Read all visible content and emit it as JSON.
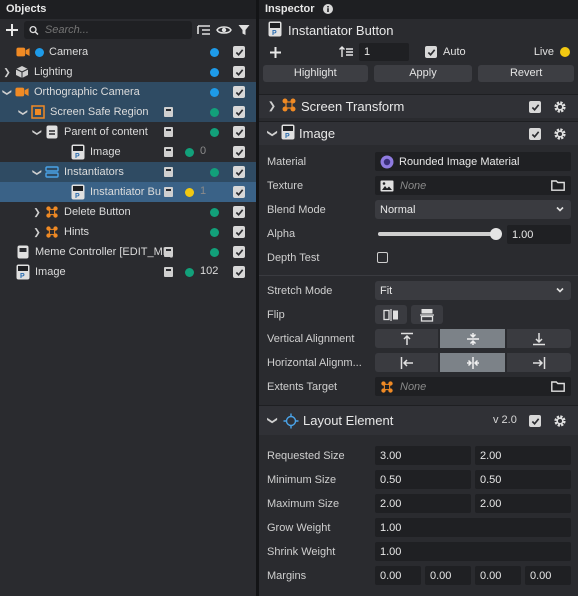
{
  "objects": {
    "title": "Objects",
    "search_placeholder": "Search...",
    "items": [
      {
        "label": "Camera",
        "icon": "camera-icon",
        "expand": "",
        "dot": "#1e9be9",
        "layer": false,
        "count": ""
      },
      {
        "label": "Lighting",
        "icon": "lighting-cube-icon",
        "expand": "right",
        "dot": "#1e9be9",
        "layer": false,
        "count": ""
      },
      {
        "label": "Orthographic Camera",
        "icon": "camera-icon",
        "expand": "down",
        "dot": "#1e9be9",
        "layer": false,
        "count": ""
      },
      {
        "label": "Screen Safe Region",
        "icon": "screen-region-icon",
        "expand": "down",
        "dot": "#12a07a",
        "layer": true,
        "count": ""
      },
      {
        "label": "Parent of content",
        "icon": "content-icon",
        "expand": "down",
        "dot": "#12a07a",
        "layer": true,
        "count": ""
      },
      {
        "label": "Image",
        "icon": "image-component-icon",
        "expand": "",
        "dot": "#12a07a",
        "layer": true,
        "count": "0"
      },
      {
        "label": "Instantiators",
        "icon": "instantiators-icon",
        "expand": "down",
        "dot": "#12a07a",
        "layer": true,
        "count": ""
      },
      {
        "label": "Instantiator Bu",
        "icon": "image-component-icon",
        "expand": "",
        "dot": "#f2c811",
        "layer": true,
        "count": "1"
      },
      {
        "label": "Delete Button",
        "icon": "screen-transform-icon",
        "expand": "right",
        "dot": "#12a07a",
        "layer": false,
        "count": ""
      },
      {
        "label": "Hints",
        "icon": "screen-transform-icon",
        "expand": "right",
        "dot": "#12a07a",
        "layer": false,
        "count": ""
      },
      {
        "label": "Meme Controller [EDIT_ME]",
        "icon": "script-icon",
        "expand": "",
        "dot": "#12a07a",
        "layer": true,
        "count": ""
      },
      {
        "label": "Image",
        "icon": "image-component-icon",
        "expand": "",
        "dot": "#12a07a",
        "layer": true,
        "count": "102"
      }
    ]
  },
  "inspector": {
    "title": "Inspector",
    "object_name": "Instantiator Button",
    "layer_value": "1",
    "auto_label": "Auto",
    "live_label": "Live",
    "buttons": {
      "highlight": "Highlight",
      "apply": "Apply",
      "revert": "Revert"
    },
    "screen_transform": {
      "title": "Screen Transform"
    },
    "image": {
      "title": "Image",
      "material_label": "Material",
      "material_value": "Rounded Image Material",
      "texture_label": "Texture",
      "texture_value": "None",
      "blend_label": "Blend Mode",
      "blend_value": "Normal",
      "alpha_label": "Alpha",
      "alpha_value": "1.00",
      "alpha_fraction": 1.0,
      "depth_label": "Depth Test",
      "stretch_label": "Stretch Mode",
      "stretch_value": "Fit",
      "flip_label": "Flip",
      "valign_label": "Vertical Alignment",
      "halign_label": "Horizontal Alignm...",
      "extents_label": "Extents Target",
      "extents_value": "None"
    },
    "layout": {
      "title": "Layout Element",
      "version": "v 2.0",
      "requested_label": "Requested Size",
      "requested": [
        "3.00",
        "2.00"
      ],
      "minimum_label": "Minimum Size",
      "minimum": [
        "0.50",
        "0.50"
      ],
      "maximum_label": "Maximum Size",
      "maximum": [
        "2.00",
        "2.00"
      ],
      "grow_label": "Grow Weight",
      "grow": "1.00",
      "shrink_label": "Shrink Weight",
      "shrink": "1.00",
      "margins_label": "Margins",
      "margins": [
        "0.00",
        "0.00",
        "0.00",
        "0.00"
      ]
    }
  }
}
